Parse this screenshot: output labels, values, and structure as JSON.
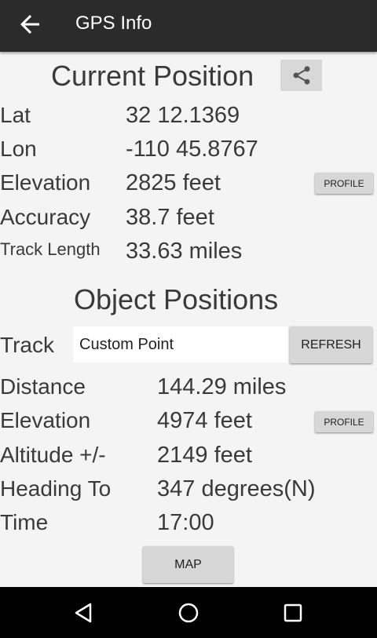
{
  "app_bar": {
    "title": "GPS Info",
    "back_icon": "arrow-left-icon"
  },
  "current_position": {
    "title": "Current Position",
    "share_icon": "share-icon",
    "rows": [
      {
        "label": "Lat",
        "value": "32 12.1369"
      },
      {
        "label": "Lon",
        "value": "-110 45.8767"
      },
      {
        "label": "Elevation",
        "value": "2825 feet"
      },
      {
        "label": "Accuracy",
        "value": "38.7 feet"
      },
      {
        "label": "Track Length",
        "value": "33.63 miles"
      }
    ],
    "profile_button": "PROFILE"
  },
  "object_positions": {
    "title": "Object Positions",
    "track_label": "Track",
    "track_value": "Custom Point",
    "refresh_button": "REFRESH",
    "rows": [
      {
        "label": "Distance",
        "value": "144.29 miles"
      },
      {
        "label": "Elevation",
        "value": "4974 feet"
      },
      {
        "label": "Altitude +/-",
        "value": "2149 feet"
      },
      {
        "label": "Heading To",
        "value": "347 degrees(N)"
      },
      {
        "label": "Time",
        "value": "17:00"
      }
    ],
    "profile_button": "PROFILE"
  },
  "map_button": "MAP",
  "nav_bar": {
    "back_icon": "nav-back-icon",
    "home_icon": "nav-home-icon",
    "recents_icon": "nav-recents-icon"
  }
}
